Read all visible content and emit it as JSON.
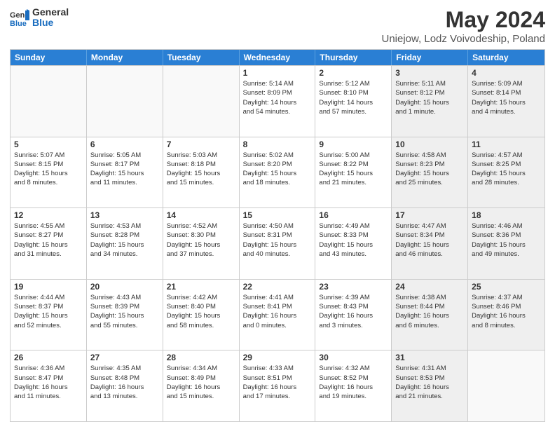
{
  "header": {
    "logo_general": "General",
    "logo_blue": "Blue",
    "main_title": "May 2024",
    "subtitle": "Uniejow, Lodz Voivodeship, Poland"
  },
  "calendar": {
    "days_of_week": [
      "Sunday",
      "Monday",
      "Tuesday",
      "Wednesday",
      "Thursday",
      "Friday",
      "Saturday"
    ],
    "weeks": [
      [
        {
          "day": "",
          "info": "",
          "empty": true
        },
        {
          "day": "",
          "info": "",
          "empty": true
        },
        {
          "day": "",
          "info": "",
          "empty": true
        },
        {
          "day": "1",
          "info": "Sunrise: 5:14 AM\nSunset: 8:09 PM\nDaylight: 14 hours\nand 54 minutes.",
          "empty": false,
          "shaded": false
        },
        {
          "day": "2",
          "info": "Sunrise: 5:12 AM\nSunset: 8:10 PM\nDaylight: 14 hours\nand 57 minutes.",
          "empty": false,
          "shaded": false
        },
        {
          "day": "3",
          "info": "Sunrise: 5:11 AM\nSunset: 8:12 PM\nDaylight: 15 hours\nand 1 minute.",
          "empty": false,
          "shaded": true
        },
        {
          "day": "4",
          "info": "Sunrise: 5:09 AM\nSunset: 8:14 PM\nDaylight: 15 hours\nand 4 minutes.",
          "empty": false,
          "shaded": true
        }
      ],
      [
        {
          "day": "5",
          "info": "Sunrise: 5:07 AM\nSunset: 8:15 PM\nDaylight: 15 hours\nand 8 minutes.",
          "empty": false,
          "shaded": false
        },
        {
          "day": "6",
          "info": "Sunrise: 5:05 AM\nSunset: 8:17 PM\nDaylight: 15 hours\nand 11 minutes.",
          "empty": false,
          "shaded": false
        },
        {
          "day": "7",
          "info": "Sunrise: 5:03 AM\nSunset: 8:18 PM\nDaylight: 15 hours\nand 15 minutes.",
          "empty": false,
          "shaded": false
        },
        {
          "day": "8",
          "info": "Sunrise: 5:02 AM\nSunset: 8:20 PM\nDaylight: 15 hours\nand 18 minutes.",
          "empty": false,
          "shaded": false
        },
        {
          "day": "9",
          "info": "Sunrise: 5:00 AM\nSunset: 8:22 PM\nDaylight: 15 hours\nand 21 minutes.",
          "empty": false,
          "shaded": false
        },
        {
          "day": "10",
          "info": "Sunrise: 4:58 AM\nSunset: 8:23 PM\nDaylight: 15 hours\nand 25 minutes.",
          "empty": false,
          "shaded": true
        },
        {
          "day": "11",
          "info": "Sunrise: 4:57 AM\nSunset: 8:25 PM\nDaylight: 15 hours\nand 28 minutes.",
          "empty": false,
          "shaded": true
        }
      ],
      [
        {
          "day": "12",
          "info": "Sunrise: 4:55 AM\nSunset: 8:27 PM\nDaylight: 15 hours\nand 31 minutes.",
          "empty": false,
          "shaded": false
        },
        {
          "day": "13",
          "info": "Sunrise: 4:53 AM\nSunset: 8:28 PM\nDaylight: 15 hours\nand 34 minutes.",
          "empty": false,
          "shaded": false
        },
        {
          "day": "14",
          "info": "Sunrise: 4:52 AM\nSunset: 8:30 PM\nDaylight: 15 hours\nand 37 minutes.",
          "empty": false,
          "shaded": false
        },
        {
          "day": "15",
          "info": "Sunrise: 4:50 AM\nSunset: 8:31 PM\nDaylight: 15 hours\nand 40 minutes.",
          "empty": false,
          "shaded": false
        },
        {
          "day": "16",
          "info": "Sunrise: 4:49 AM\nSunset: 8:33 PM\nDaylight: 15 hours\nand 43 minutes.",
          "empty": false,
          "shaded": false
        },
        {
          "day": "17",
          "info": "Sunrise: 4:47 AM\nSunset: 8:34 PM\nDaylight: 15 hours\nand 46 minutes.",
          "empty": false,
          "shaded": true
        },
        {
          "day": "18",
          "info": "Sunrise: 4:46 AM\nSunset: 8:36 PM\nDaylight: 15 hours\nand 49 minutes.",
          "empty": false,
          "shaded": true
        }
      ],
      [
        {
          "day": "19",
          "info": "Sunrise: 4:44 AM\nSunset: 8:37 PM\nDaylight: 15 hours\nand 52 minutes.",
          "empty": false,
          "shaded": false
        },
        {
          "day": "20",
          "info": "Sunrise: 4:43 AM\nSunset: 8:39 PM\nDaylight: 15 hours\nand 55 minutes.",
          "empty": false,
          "shaded": false
        },
        {
          "day": "21",
          "info": "Sunrise: 4:42 AM\nSunset: 8:40 PM\nDaylight: 15 hours\nand 58 minutes.",
          "empty": false,
          "shaded": false
        },
        {
          "day": "22",
          "info": "Sunrise: 4:41 AM\nSunset: 8:41 PM\nDaylight: 16 hours\nand 0 minutes.",
          "empty": false,
          "shaded": false
        },
        {
          "day": "23",
          "info": "Sunrise: 4:39 AM\nSunset: 8:43 PM\nDaylight: 16 hours\nand 3 minutes.",
          "empty": false,
          "shaded": false
        },
        {
          "day": "24",
          "info": "Sunrise: 4:38 AM\nSunset: 8:44 PM\nDaylight: 16 hours\nand 6 minutes.",
          "empty": false,
          "shaded": true
        },
        {
          "day": "25",
          "info": "Sunrise: 4:37 AM\nSunset: 8:46 PM\nDaylight: 16 hours\nand 8 minutes.",
          "empty": false,
          "shaded": true
        }
      ],
      [
        {
          "day": "26",
          "info": "Sunrise: 4:36 AM\nSunset: 8:47 PM\nDaylight: 16 hours\nand 11 minutes.",
          "empty": false,
          "shaded": false
        },
        {
          "day": "27",
          "info": "Sunrise: 4:35 AM\nSunset: 8:48 PM\nDaylight: 16 hours\nand 13 minutes.",
          "empty": false,
          "shaded": false
        },
        {
          "day": "28",
          "info": "Sunrise: 4:34 AM\nSunset: 8:49 PM\nDaylight: 16 hours\nand 15 minutes.",
          "empty": false,
          "shaded": false
        },
        {
          "day": "29",
          "info": "Sunrise: 4:33 AM\nSunset: 8:51 PM\nDaylight: 16 hours\nand 17 minutes.",
          "empty": false,
          "shaded": false
        },
        {
          "day": "30",
          "info": "Sunrise: 4:32 AM\nSunset: 8:52 PM\nDaylight: 16 hours\nand 19 minutes.",
          "empty": false,
          "shaded": false
        },
        {
          "day": "31",
          "info": "Sunrise: 4:31 AM\nSunset: 8:53 PM\nDaylight: 16 hours\nand 21 minutes.",
          "empty": false,
          "shaded": true
        },
        {
          "day": "",
          "info": "",
          "empty": true,
          "shaded": true
        }
      ]
    ]
  }
}
